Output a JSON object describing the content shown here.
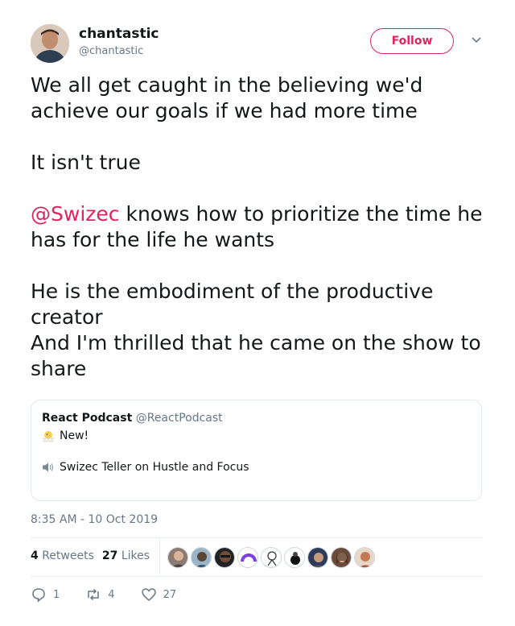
{
  "author": {
    "name": "chantastic",
    "handle": "@chantastic"
  },
  "follow_label": "Follow",
  "tweet": {
    "line1": "We all get caught in the believing we'd achieve our goals if we had more time",
    "line2": "It isn't true",
    "mention": "@Swizec",
    "line3_rest": " knows how to prioritize the time he has for the life he wants",
    "line4": "He is the embodiment of the productive creator",
    "line5": "And I'm thrilled that he came on the show to share"
  },
  "quote": {
    "name": "React Podcast",
    "handle": "@ReactPodcast",
    "line1": "New!",
    "line2": "Swizec Teller on Hustle and Focus",
    "line1_icon": "hatching-chick-icon",
    "line2_icon": "speaker-icon"
  },
  "timestamp": "8:35 AM - 10 Oct 2019",
  "stats": {
    "retweets_count": "4",
    "retweets_label": "Retweets",
    "likes_count": "27",
    "likes_label": "Likes"
  },
  "actions": {
    "reply_count": "1",
    "retweet_count": "4",
    "like_count": "27"
  },
  "colors": {
    "accent": "#e0245e",
    "secondary_text": "#657786",
    "border": "#e1e8ed"
  }
}
